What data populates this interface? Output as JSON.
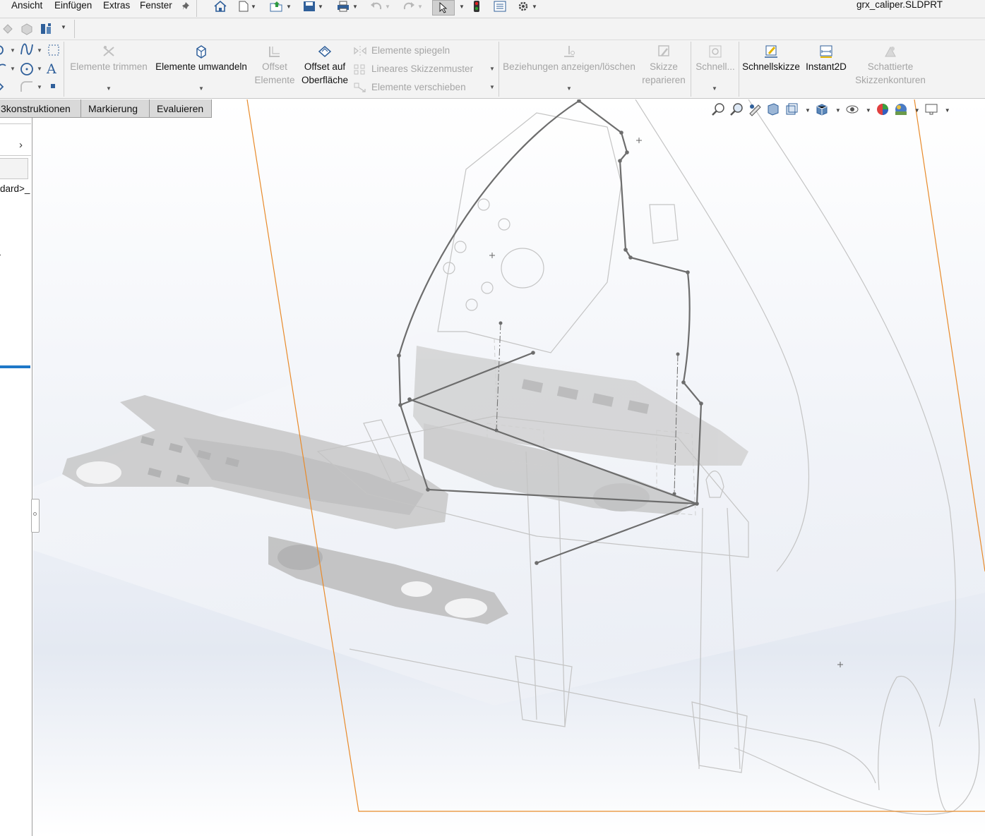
{
  "menu": {
    "items": [
      "Ansicht",
      "Einfügen",
      "Extras",
      "Fenster"
    ],
    "document_title": "grx_caliper.SLDPRT"
  },
  "tabs": [
    "Skizzenkonstruktionen",
    "Markierung",
    "Evaluieren"
  ],
  "tabs_visible_text": [
    "3konstruktionen",
    "Markierung",
    "Evaluieren"
  ],
  "ribbon": {
    "trim": "Elemente trimmen",
    "convert": "Elemente umwandeln",
    "offset_line1": "Offset",
    "offset_line2": "Elemente",
    "offset_surface_line1": "Offset auf",
    "offset_surface_line2": "Oberfläche",
    "mirror": "Elemente spiegeln",
    "linear_pattern": "Lineares Skizzenmuster",
    "move": "Elemente verschieben",
    "relations": "Beziehungen anzeigen/löschen",
    "repair_line1": "Skizze",
    "repair_line2": "reparieren",
    "quick_snaps": "Schnell...",
    "rapid_sketch": "Schnellskizze",
    "instant2d": "Instant2D",
    "shaded_line1": "Schattierte",
    "shaded_line2": "Skizzenkonturen"
  },
  "left_panel": {
    "config_text": "dard>_"
  },
  "colors": {
    "accent_blue": "#1e78c8",
    "sketch_plane_orange": "#e88a2a",
    "disabled_text": "#a5a5a5"
  }
}
